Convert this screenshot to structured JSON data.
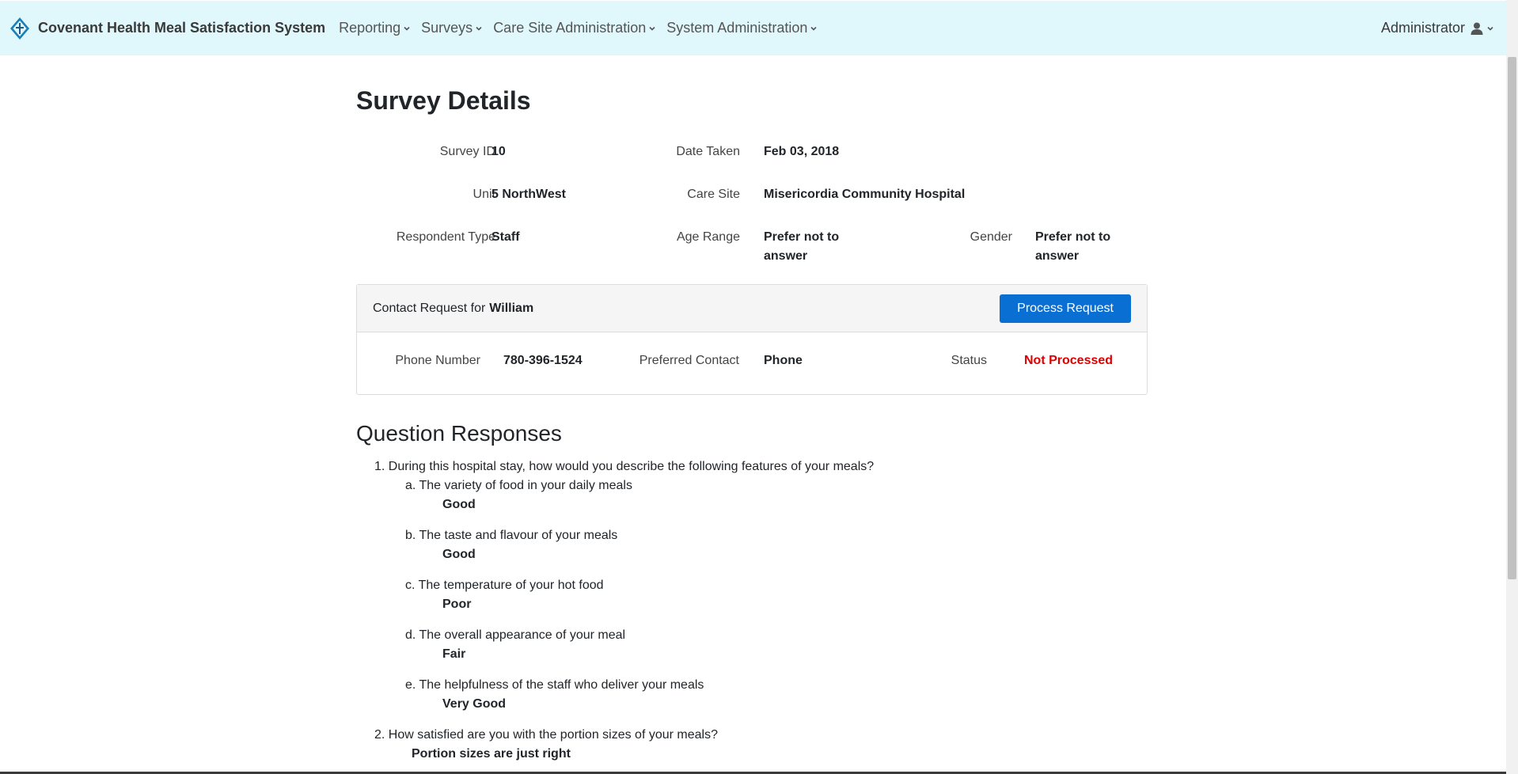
{
  "nav": {
    "brand": "Covenant Health Meal Satisfaction System",
    "menus": [
      "Reporting",
      "Surveys",
      "Care Site Administration",
      "System Administration"
    ],
    "user": "Administrator"
  },
  "page_title": "Survey Details",
  "survey": {
    "survey_id_label": "Survey ID",
    "survey_id": "10",
    "date_label": "Date Taken",
    "date": "Feb 03, 2018",
    "unit_label": "Unit",
    "unit": "5 NorthWest",
    "care_site_label": "Care Site",
    "care_site": "Misericordia Community Hospital",
    "respondent_label": "Respondent Type",
    "respondent": "Staff",
    "age_label": "Age Range",
    "age_line1": "Prefer not to",
    "age_line2": "answer",
    "gender_label": "Gender",
    "gender_line1": "Prefer not to",
    "gender_line2": "answer"
  },
  "contact": {
    "header_prefix": "Contact Request for",
    "name": "William",
    "process_button": "Process Request",
    "phone_label": "Phone Number",
    "phone": "780-396-1524",
    "preferred_label": "Preferred Contact",
    "preferred": "Phone",
    "status_label": "Status",
    "status": "Not Processed",
    "status_color": "#e00000"
  },
  "responses_title": "Question Responses",
  "questions": [
    {
      "number": "1.",
      "text": "During this hospital stay, how would you describe the following features of your meals?",
      "subs": [
        {
          "letter": "a.",
          "text": "The variety of food in your daily meals",
          "answer": "Good"
        },
        {
          "letter": "b.",
          "text": "The taste and flavour of your meals",
          "answer": "Good"
        },
        {
          "letter": "c.",
          "text": "The temperature of your hot food",
          "answer": "Poor"
        },
        {
          "letter": "d.",
          "text": "The overall appearance of your meal",
          "answer": "Fair"
        },
        {
          "letter": "e.",
          "text": "The helpfulness of the staff who deliver your meals",
          "answer": "Very Good"
        }
      ]
    },
    {
      "number": "2.",
      "text": "How satisfied are you with the portion sizes of your meals?",
      "answer": "Portion sizes are just right"
    }
  ],
  "colors": {
    "navbar_bg": "#e0f7fc",
    "primary": "#0a6fd2"
  }
}
